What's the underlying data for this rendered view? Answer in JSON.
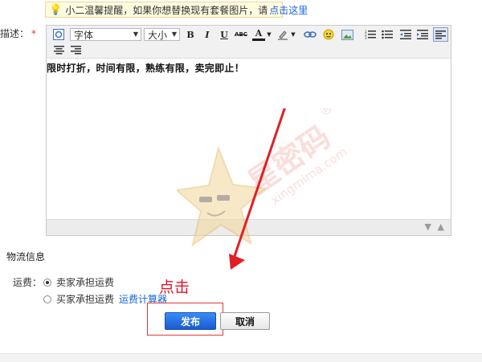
{
  "tip": {
    "text": "小二温馨提醒，如果你想替换现有套餐图片，请",
    "link": "点击这里",
    "icon": "lightbulb-icon"
  },
  "description": {
    "label": "描述：",
    "required_mark": "*"
  },
  "toolbar": {
    "font_select": "字体",
    "size_select": "大小",
    "bold": "B",
    "italic": "I",
    "underline": "U",
    "strikethrough": "ABC",
    "font_color": "A",
    "icons": [
      "source-icon",
      "bold-icon",
      "italic-icon",
      "underline-icon",
      "strikethrough-icon",
      "font-color-icon",
      "highlight-icon",
      "link-icon",
      "emoji-icon",
      "image-icon",
      "ordered-list-icon",
      "unordered-list-icon",
      "outdent-icon",
      "indent-icon",
      "align-left-icon",
      "align-center-icon",
      "align-right-icon"
    ]
  },
  "editor": {
    "content": "限时打折，时间有限，熟练有限，卖完即止！",
    "bottom_icons": [
      "arrow-down-icon",
      "arrow-up-icon"
    ]
  },
  "watermark": {
    "brand": "星密码",
    "url": "xingmima.com",
    "mark": "®"
  },
  "logistics": {
    "title": "物流信息",
    "freight_label": "运费：",
    "options": [
      "卖家承担运费",
      "买家承担运费"
    ],
    "selected_index": 0,
    "calc_link": "运费计算器"
  },
  "annotation": {
    "click_hint": "点击",
    "color": "#e0142a"
  },
  "actions": {
    "publish": "发布",
    "cancel": "取消"
  }
}
